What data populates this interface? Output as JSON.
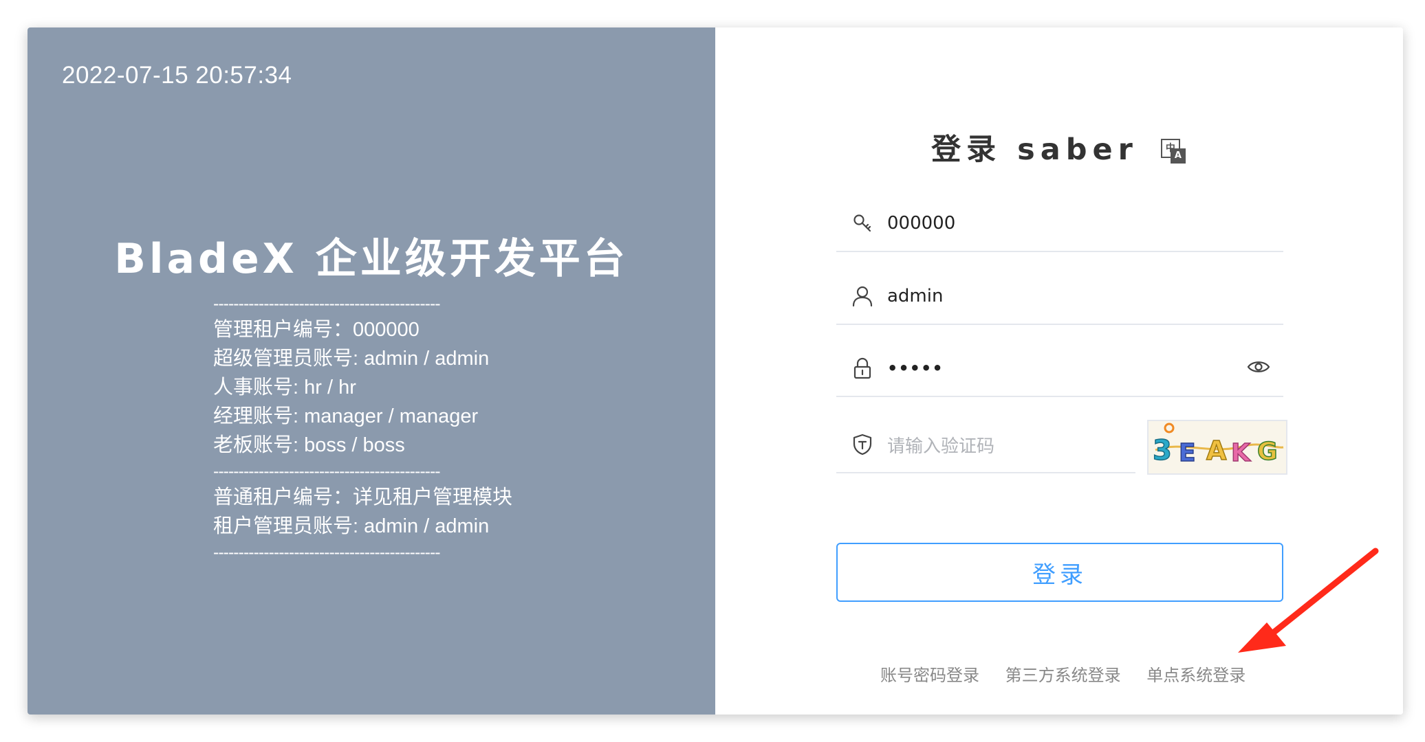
{
  "left_panel": {
    "datetime": "2022-07-15 20:57:34",
    "brand_title": "BladeX 企业级开发平台",
    "separator": "---------------------------------------------",
    "lines_group1": [
      "管理租户编号：000000",
      "超级管理员账号: admin / admin",
      "人事账号: hr / hr",
      "经理账号: manager / manager",
      "老板账号: boss / boss"
    ],
    "lines_group2": [
      "普通租户编号：详见租户管理模块",
      "租户管理员账号: admin / admin"
    ]
  },
  "right_panel": {
    "title": "登录 saber",
    "lang_icon": {
      "top": "中",
      "bottom": "A"
    },
    "tenant_value": "000000",
    "username_value": "admin",
    "password_value": "•••••",
    "captcha_placeholder": "请输入验证码",
    "captcha_text": "3EAKG",
    "login_button": "登录",
    "links": [
      "账号密码登录",
      "第三方系统登录",
      "单点系统登录"
    ]
  },
  "colors": {
    "left_bg": "#8b9aad",
    "accent": "#409eff",
    "annotation_arrow": "#ff2a1a"
  }
}
